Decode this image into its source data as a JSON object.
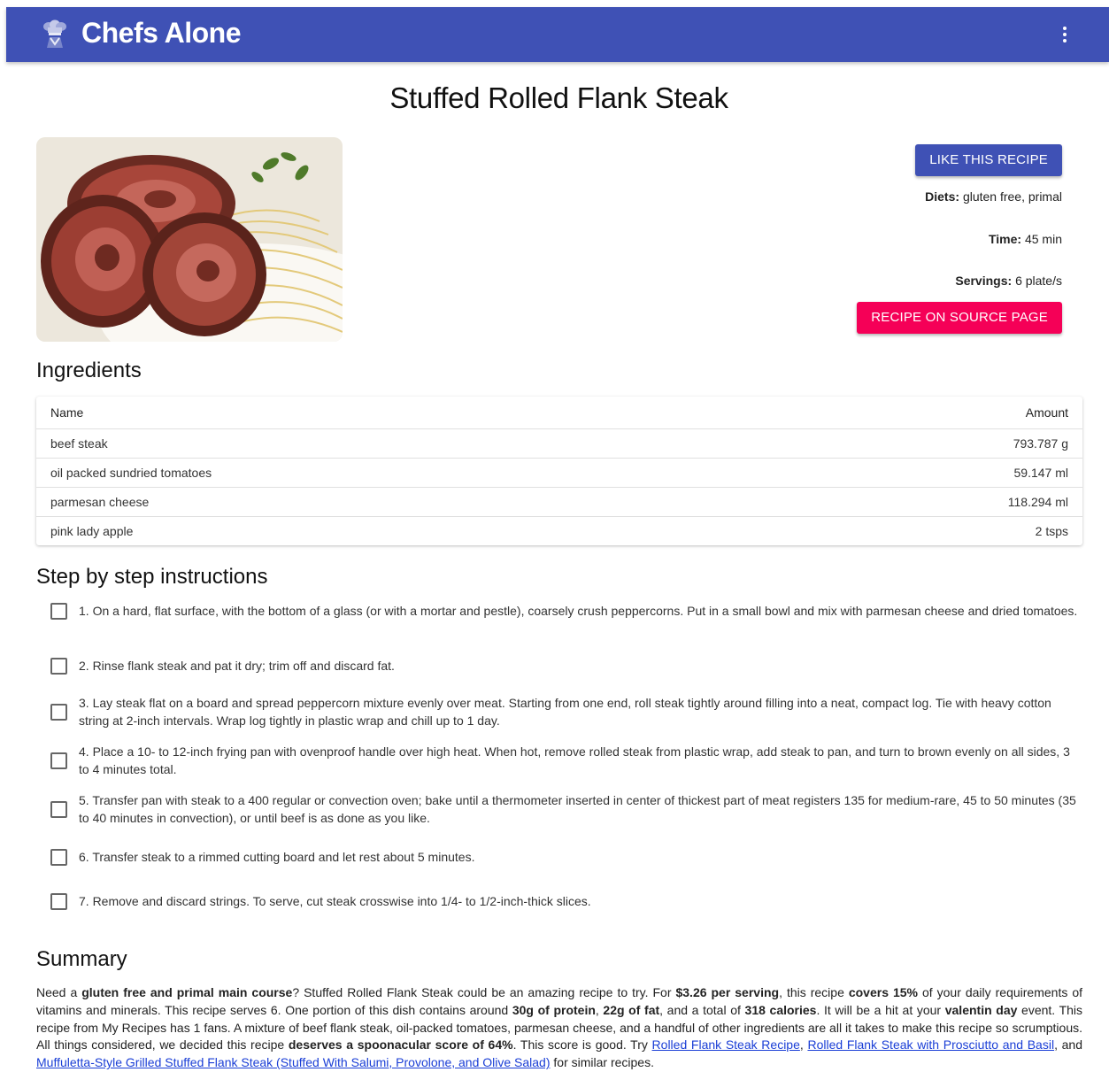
{
  "app": {
    "title": "Chefs Alone",
    "logo_icon": "chef-hat-icon",
    "menu_icon": "more-vert-icon"
  },
  "recipe": {
    "title": "Stuffed Rolled Flank Steak",
    "image_alt": "stuffed-rolled-flank-steak-photo",
    "like_button": "LIKE THIS RECIPE",
    "source_button": "RECIPE ON SOURCE PAGE",
    "diets_label": "Diets:",
    "diets_value": "gluten free, primal",
    "time_label": "Time:",
    "time_value": "45 min",
    "servings_label": "Servings:",
    "servings_value": "6 plate/s"
  },
  "ingredients": {
    "heading": "Ingredients",
    "columns": {
      "name": "Name",
      "amount": "Amount"
    },
    "rows": [
      {
        "name": "beef steak",
        "amount": "793.787 g"
      },
      {
        "name": "oil packed sundried tomatoes",
        "amount": "59.147 ml"
      },
      {
        "name": "parmesan cheese",
        "amount": "118.294 ml"
      },
      {
        "name": "pink lady apple",
        "amount": "2 tsps"
      }
    ]
  },
  "instructions": {
    "heading": "Step by step instructions",
    "steps": [
      "1. On a hard, flat surface, with the bottom of a glass (or with a mortar and pestle), coarsely crush peppercorns. Put in a small bowl and mix with parmesan cheese and dried tomatoes.",
      "2. Rinse flank steak and pat it dry; trim off and discard fat.",
      "3. Lay steak flat on a board and spread peppercorn mixture evenly over meat. Starting from one end, roll steak tightly around filling into a neat, compact log. Tie with heavy cotton string at 2-inch intervals. Wrap log tightly in plastic wrap and chill up to 1 day.",
      "4. Place a 10- to 12-inch frying pan with ovenproof handle over high heat. When hot, remove rolled steak from plastic wrap, add steak to pan, and turn to brown evenly on all sides, 3 to 4 minutes total.",
      "5. Transfer pan with steak to a 400 regular or convection oven; bake until a thermometer inserted in center of thickest part of meat registers 135 for medium-rare, 45 to 50 minutes (35 to 40 minutes in convection), or until beef is as done as you like.",
      "6. Transfer steak to a rimmed cutting board and let rest about 5 minutes.",
      "7. Remove and discard strings. To serve, cut steak crosswise into 1/4- to 1/2-inch-thick slices."
    ]
  },
  "summary": {
    "heading": "Summary",
    "t1": "Need a ",
    "b1": "gluten free and primal main course",
    "t2": "? Stuffed Rolled Flank Steak could be an amazing recipe to try. For ",
    "b2": "$3.26 per serving",
    "t3": ", this recipe ",
    "b3": "covers 15%",
    "t4": " of your daily requirements of vitamins and minerals. This recipe serves 6. One portion of this dish contains around ",
    "b4": "30g of protein",
    "t5": ", ",
    "b5": "22g of fat",
    "t6": ", and a total of ",
    "b6": "318 calories",
    "t7": ". It will be a hit at your ",
    "b7": "valentin day",
    "t8": " event. This recipe from My Recipes has 1 fans. A mixture of beef flank steak, oil-packed tomatoes, parmesan cheese, and a handful of other ingredients are all it takes to make this recipe so scrumptious. All things considered, we decided this recipe ",
    "b8": "deserves a spoonacular score of 64%",
    "t9": ". This score is good. Try ",
    "link1": "Rolled Flank Steak Recipe",
    "t10": ", ",
    "link2": "Rolled Flank Steak with Prosciutto and Basil",
    "t11": ", and ",
    "link3": "Muffuletta-Style Grilled Stuffed Flank Steak (Stuffed With Salumi, Provolone, and Olive Salad)",
    "t12": " for similar recipes."
  },
  "colors": {
    "app_bar": "#3f51b5",
    "primary_button": "#3f51b5",
    "secondary_button": "#f50057",
    "link": "#1a3ed6"
  }
}
